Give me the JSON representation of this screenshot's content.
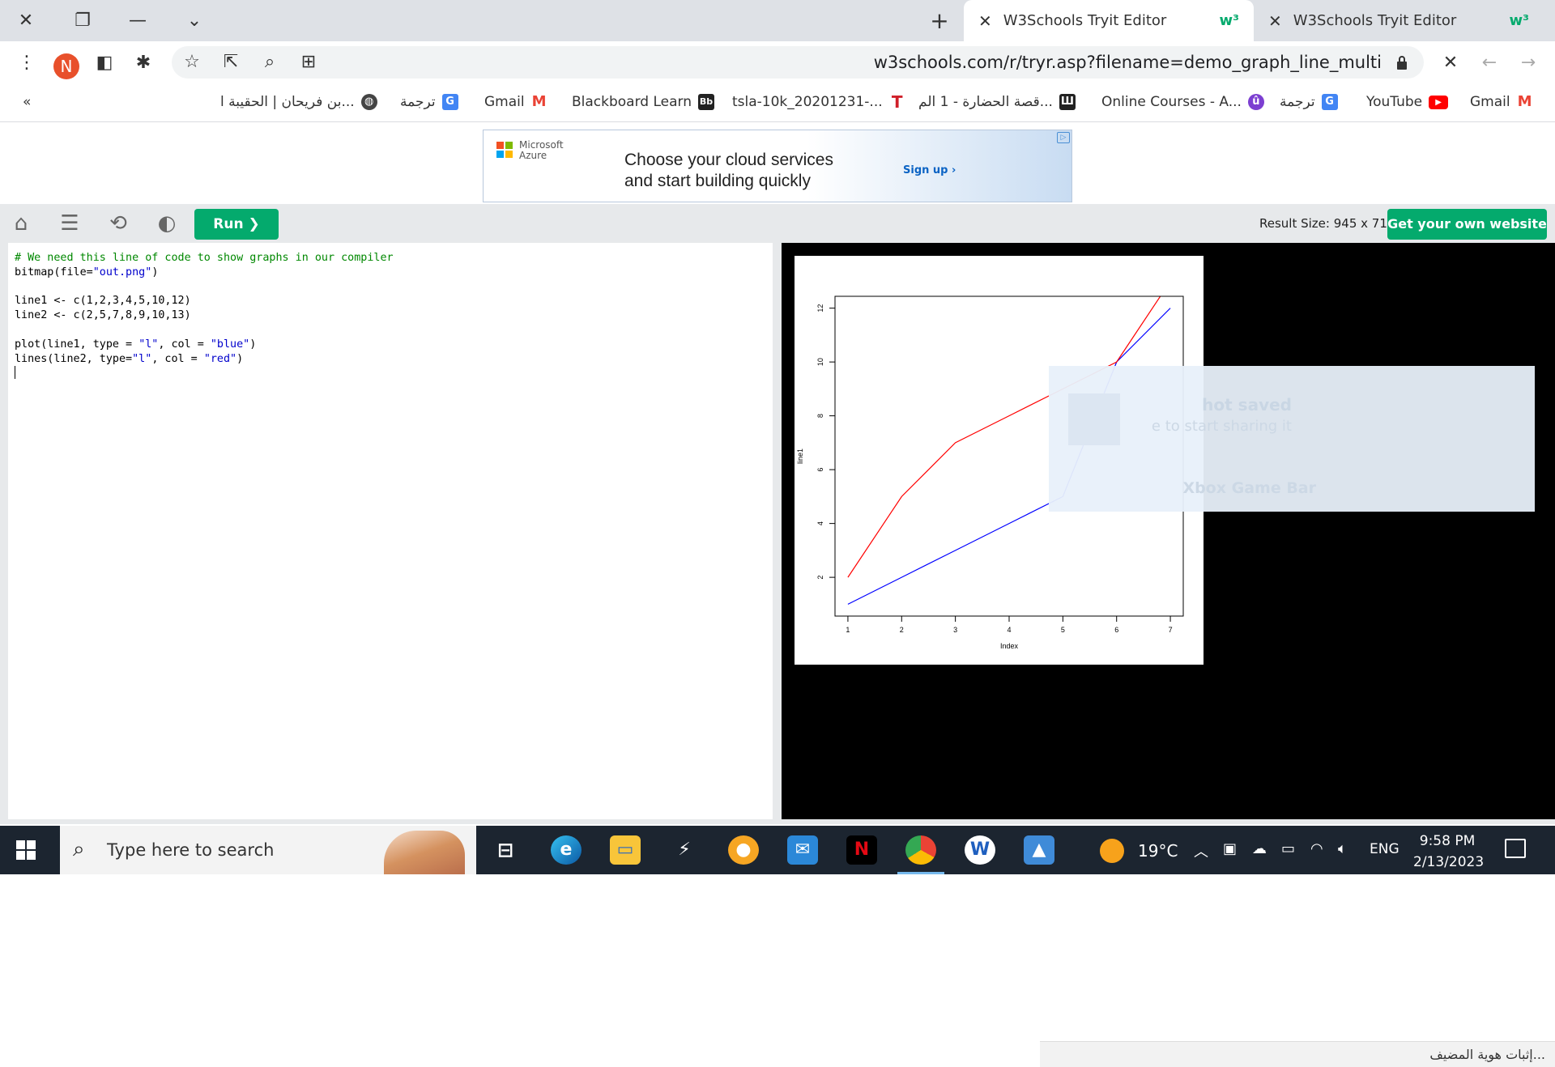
{
  "browser": {
    "tabs": [
      {
        "label": "W3Schools Tryit Editor",
        "active": true
      },
      {
        "label": "W3Schools Tryit Editor",
        "active": false
      }
    ],
    "url": "w3schools.com/r/tryr.asp?filename=demo_graph_line_multi",
    "profile_initial": "N",
    "bookmarks": [
      {
        "label": "Gmail",
        "icon": "gmail-icon"
      },
      {
        "label": "YouTube",
        "icon": "youtube-icon"
      },
      {
        "label": "ترجمة",
        "icon": "translate-icon"
      },
      {
        "label": "Online Courses - A...",
        "icon": "courses-icon"
      },
      {
        "label": "قصة الحضارة - 1 الم...",
        "icon": "library-icon"
      },
      {
        "label": "tsla-10k_20201231-...",
        "icon": "tesla-icon"
      },
      {
        "label": "Blackboard Learn",
        "icon": "blackboard-icon"
      },
      {
        "label": "Gmail",
        "icon": "gmail-icon"
      },
      {
        "label": "ترجمة",
        "icon": "translate-icon"
      },
      {
        "label": "بن فريحان | الحقيبة ا...",
        "icon": "globe-icon"
      }
    ],
    "bookmarks_more": "«"
  },
  "ad": {
    "brand_line1": "Microsoft",
    "brand_line2": "Azure",
    "headline_line1": "Choose your cloud services",
    "headline_line2": "and start building quickly",
    "cta": "Sign up ›"
  },
  "editor": {
    "run_label": "Run ❯",
    "result_size": "Result Size: 945 x 711",
    "get_website": "Get your own website",
    "code": {
      "comment": "# We need this line of code to show graphs in our compiler",
      "bitmap_pre": "bitmap(file=",
      "bitmap_str": "\"out.png\"",
      "bitmap_post": ")",
      "line1": "line1 <- c(1,2,3,4,5,10,12)",
      "line2": "line2 <- c(2,5,7,8,9,10,13)",
      "plot_pre": "plot(line1, type = ",
      "plot_s1": "\"l\"",
      "plot_mid": ", col = ",
      "plot_s2": "\"blue\"",
      "plot_post": ")",
      "lines_pre": "lines(line2, type=",
      "lines_s1": "\"l\"",
      "lines_mid": ", col = ",
      "lines_s2": "\"red\"",
      "lines_post": ")"
    }
  },
  "chart_data": {
    "type": "line",
    "x": [
      1,
      2,
      3,
      4,
      5,
      6,
      7
    ],
    "series": [
      {
        "name": "line1",
        "color": "#0000ff",
        "values": [
          1,
          2,
          3,
          4,
          5,
          10,
          12
        ]
      },
      {
        "name": "line2",
        "color": "#ff0000",
        "values": [
          2,
          5,
          7,
          8,
          9,
          10,
          13
        ]
      }
    ],
    "xlabel": "Index",
    "ylabel": "line1",
    "xticks": [
      1,
      2,
      3,
      4,
      5,
      6,
      7
    ],
    "yticks": [
      2,
      4,
      6,
      8,
      10,
      12
    ],
    "xlim": [
      0.76,
      7.24
    ],
    "ylim": [
      0.56,
      12.44
    ]
  },
  "overlay": {
    "title": "hot saved",
    "subtitle": "e to start sharing it",
    "footer": "Xbox Game Bar"
  },
  "identity_bar": "إثبات هوية المضيف...",
  "taskbar": {
    "search_placeholder": "Type here to search",
    "temperature": "19°C",
    "language": "ENG",
    "time": "9:58 PM",
    "date": "2/13/2023"
  }
}
